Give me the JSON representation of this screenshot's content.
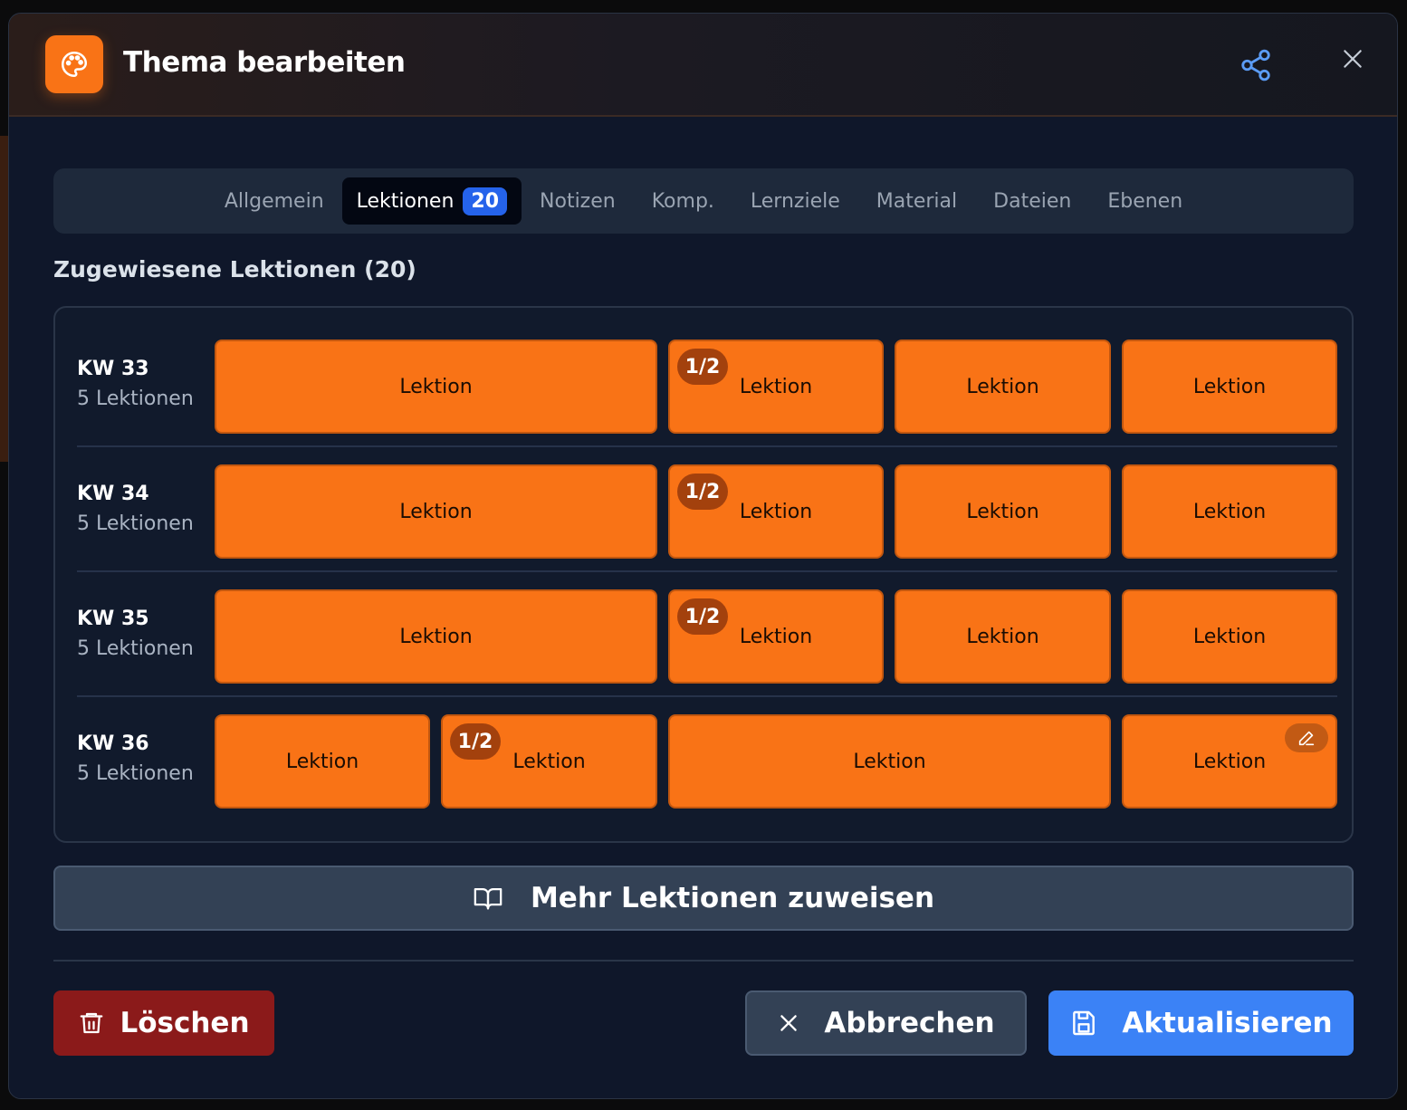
{
  "modal": {
    "title": "Thema bearbeiten"
  },
  "tabs": [
    {
      "label": "Allgemein"
    },
    {
      "label": "Lektionen",
      "badge": "20",
      "active": true
    },
    {
      "label": "Notizen"
    },
    {
      "label": "Komp."
    },
    {
      "label": "Lernziele"
    },
    {
      "label": "Material"
    },
    {
      "label": "Dateien"
    },
    {
      "label": "Ebenen"
    }
  ],
  "section_title": "Zugewiesene Lektionen (20)",
  "weeks": [
    {
      "name": "KW 33",
      "count": "5 Lektionen",
      "lessons": [
        {
          "label": "Lektion"
        },
        {
          "label": "Lektion",
          "badge": "1/2"
        },
        {
          "label": "Lektion"
        },
        {
          "label": "Lektion"
        }
      ]
    },
    {
      "name": "KW 34",
      "count": "5 Lektionen",
      "lessons": [
        {
          "label": "Lektion"
        },
        {
          "label": "Lektion",
          "badge": "1/2"
        },
        {
          "label": "Lektion"
        },
        {
          "label": "Lektion"
        }
      ]
    },
    {
      "name": "KW 35",
      "count": "5 Lektionen",
      "lessons": [
        {
          "label": "Lektion"
        },
        {
          "label": "Lektion",
          "badge": "1/2"
        },
        {
          "label": "Lektion"
        },
        {
          "label": "Lektion"
        }
      ]
    },
    {
      "name": "KW 36",
      "count": "5 Lektionen",
      "lessons": [
        {
          "label": "Lektion"
        },
        {
          "label": "Lektion",
          "badge": "1/2"
        },
        {
          "label": "Lektion"
        },
        {
          "label": "Lektion",
          "icon": "pencil-icon"
        }
      ]
    }
  ],
  "assign_button": {
    "label": "Mehr Lektionen zuweisen",
    "icon": "book-open-icon"
  },
  "footer": {
    "delete_label": "Löschen",
    "cancel_label": "Abbrechen",
    "update_label": "Aktualisieren"
  },
  "colors": {
    "accent_orange": "#f97316",
    "primary_blue": "#3b82f6",
    "danger_red": "#8b1a1a",
    "surface": "#0f172a"
  }
}
